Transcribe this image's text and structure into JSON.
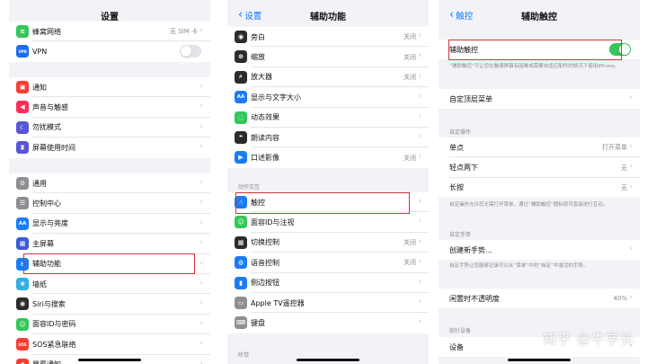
{
  "panel1": {
    "title": "设置",
    "group1": [
      {
        "label": "蜂窝网络",
        "value": "无 SIM 卡",
        "icon": "cellular-icon",
        "color": "#34c759",
        "glyph": "≋"
      },
      {
        "label": "VPN",
        "icon": "vpn-icon",
        "color": "#1a6cf0",
        "glyph": "VPN",
        "toggle": false
      }
    ],
    "group2": [
      {
        "label": "通知",
        "icon": "notification-icon",
        "color": "#ff3b30",
        "glyph": "▣"
      },
      {
        "label": "声音与触感",
        "icon": "sound-icon",
        "color": "#ff2d55",
        "glyph": "◀"
      },
      {
        "label": "勿扰模式",
        "icon": "moon-icon",
        "color": "#5856d6",
        "glyph": "☾"
      },
      {
        "label": "屏幕使用时间",
        "icon": "hourglass-icon",
        "color": "#5856d6",
        "glyph": "⧗"
      }
    ],
    "group3": [
      {
        "label": "通用",
        "icon": "gear-icon",
        "color": "#8e8e93",
        "glyph": "⚙"
      },
      {
        "label": "控制中心",
        "icon": "control-center-icon",
        "color": "#8e8e93",
        "glyph": "☰"
      },
      {
        "label": "显示与亮度",
        "icon": "display-icon",
        "color": "#1a7cf5",
        "glyph": "AA"
      },
      {
        "label": "主屏幕",
        "icon": "home-screen-icon",
        "color": "#3b5bdb",
        "glyph": "▦"
      },
      {
        "label": "辅助功能",
        "icon": "accessibility-icon",
        "color": "#1a7cf5",
        "glyph": "♿"
      },
      {
        "label": "墙纸",
        "icon": "wallpaper-icon",
        "color": "#32ade6",
        "glyph": "❀"
      },
      {
        "label": "Siri与搜索",
        "icon": "siri-icon",
        "color": "#2c2c2e",
        "glyph": "◉"
      },
      {
        "label": "面容ID与密码",
        "icon": "faceid-icon",
        "color": "#34c759",
        "glyph": "☺"
      },
      {
        "label": "SOS紧急联络",
        "icon": "sos-icon",
        "color": "#ff3b30",
        "glyph": "SOS"
      },
      {
        "label": "暴露通知",
        "icon": "exposure-icon",
        "color": "#ff3b30",
        "glyph": "✺"
      }
    ]
  },
  "panel2": {
    "back": "设置",
    "title": "辅助功能",
    "group1": [
      {
        "label": "旁白",
        "value": "关闭",
        "icon": "voiceover-icon",
        "color": "#2c2c2e",
        "glyph": "◉"
      },
      {
        "label": "缩放",
        "value": "关闭",
        "icon": "zoom-icon",
        "color": "#2c2c2e",
        "glyph": "⊕"
      },
      {
        "label": "放大器",
        "value": "关闭",
        "icon": "magnifier-icon",
        "color": "#2c2c2e",
        "glyph": "⌕"
      },
      {
        "label": "显示与文字大小",
        "icon": "text-size-icon",
        "color": "#1a7cf5",
        "glyph": "AA"
      },
      {
        "label": "动态效果",
        "icon": "motion-icon",
        "color": "#34c759",
        "glyph": "◌"
      },
      {
        "label": "朗读内容",
        "icon": "speech-icon",
        "color": "#2c2c2e",
        "glyph": "❝"
      },
      {
        "label": "口述影像",
        "value": "关闭",
        "icon": "audio-description-icon",
        "color": "#1a7cf5",
        "glyph": "▶"
      }
    ],
    "section": "动作交互",
    "group2": [
      {
        "label": "触控",
        "icon": "touch-icon",
        "color": "#1a7cf5",
        "glyph": "☝"
      },
      {
        "label": "面容ID与注视",
        "icon": "faceid-icon",
        "color": "#34c759",
        "glyph": "☺"
      },
      {
        "label": "切换控制",
        "value": "关闭",
        "icon": "switch-control-icon",
        "color": "#2c2c2e",
        "glyph": "▦"
      },
      {
        "label": "语音控制",
        "value": "关闭",
        "icon": "voice-control-icon",
        "color": "#1a7cf5",
        "glyph": "◍"
      },
      {
        "label": "侧边按钮",
        "icon": "side-button-icon",
        "color": "#1a7cf5",
        "glyph": "▮"
      },
      {
        "label": "Apple TV遥控器",
        "icon": "remote-icon",
        "color": "#8e8e93",
        "glyph": "▭"
      },
      {
        "label": "键盘",
        "icon": "keyboard-icon",
        "color": "#8e8e93",
        "glyph": "⌨"
      }
    ],
    "section2": "听觉"
  },
  "panel3": {
    "back": "触控",
    "title": "辅助触控",
    "assistive": {
      "label": "辅助触控",
      "toggle": true
    },
    "note1": "“辅助触控”可让您在触摸屏幕有困难或需要自适应配件的情况下使用iPhone。",
    "customize": "自定顶层菜单",
    "section_custom": "自定操作",
    "custom_rows": [
      {
        "label": "单点",
        "value": "打开菜单"
      },
      {
        "label": "轻点两下",
        "value": "无"
      },
      {
        "label": "长按",
        "value": "无"
      }
    ],
    "note2": "自定操作允许您无需打开菜单，通过“辅助触控”图标即可直接进行互动。",
    "section_gesture": "自定手势",
    "create_gesture": "创建新手势…",
    "note3": "自定手势让您能够记录可以从“菜单”中的“自定”中激活的手势。",
    "idle_opacity": {
      "label": "闲置时不透明度",
      "value": "40%"
    },
    "section_pointer": "指针设备",
    "devices": "设备"
  },
  "watermark": "知乎 @牛学长"
}
